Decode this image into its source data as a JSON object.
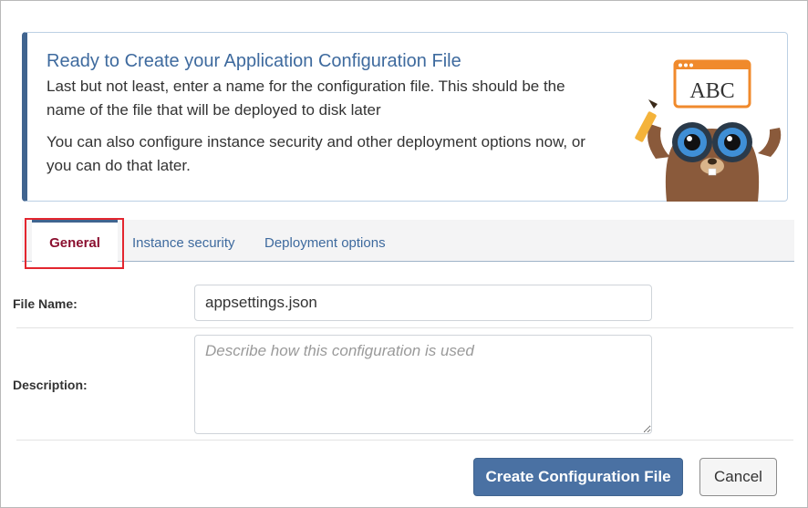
{
  "banner": {
    "title": "Ready to Create your Application Configuration File",
    "paragraph1": "Last but not least, enter a name for the configuration file. This should be the name of the file that will be deployed to disk later",
    "paragraph2": "You can also configure instance security and other deployment options now, or you can do that later.",
    "mascot_sign": "ABC"
  },
  "tabs": [
    {
      "label": "General",
      "active": true
    },
    {
      "label": "Instance security",
      "active": false
    },
    {
      "label": "Deployment options",
      "active": false
    }
  ],
  "form": {
    "file_name_label": "File Name:",
    "file_name_value": "appsettings.json",
    "description_label": "Description:",
    "description_placeholder": "Describe how this configuration is used"
  },
  "buttons": {
    "create": "Create Configuration File",
    "cancel": "Cancel"
  },
  "colors": {
    "accent": "#40648f",
    "active_tab_text": "#8b1030",
    "highlight": "#e3262f"
  }
}
